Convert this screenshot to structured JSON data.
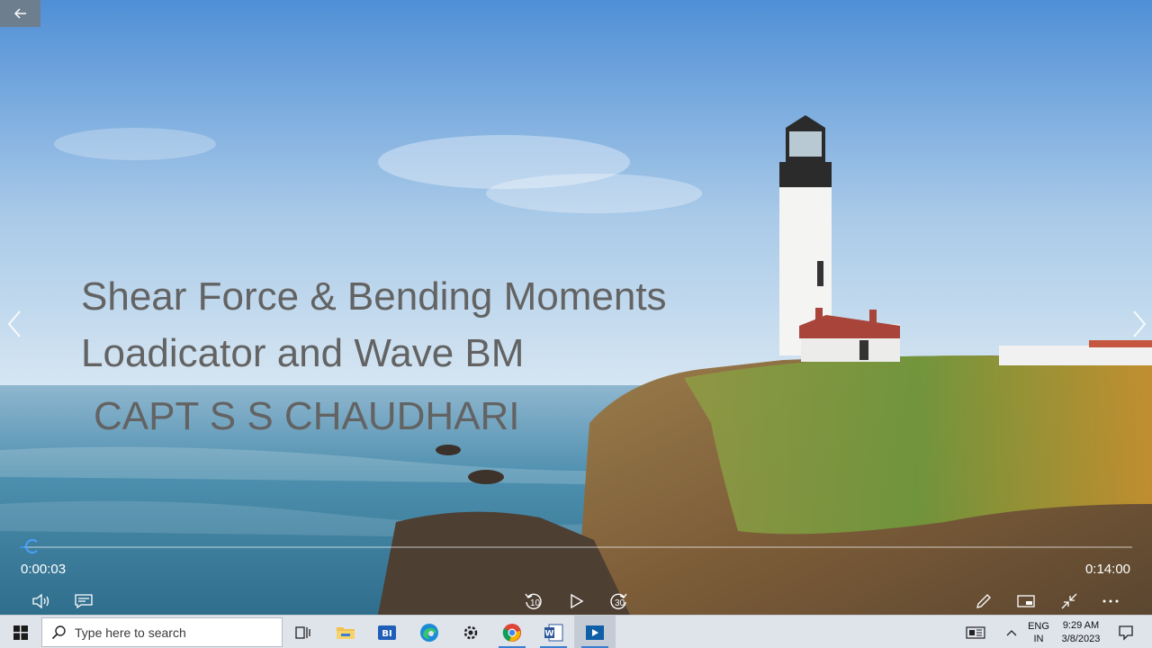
{
  "slide": {
    "line1": "Shear Force & Bending Moments",
    "line2": "Loadicator and Wave BM",
    "line3": "CAPT S S CHAUDHARI"
  },
  "player": {
    "time_current": "0:00:03",
    "time_total": "0:14:00",
    "progress": 0.004,
    "skip_back": "10",
    "skip_forward": "30"
  },
  "taskbar": {
    "search_placeholder": "Type here to search",
    "apps": [
      "task-view",
      "file-explorer",
      "bi-app",
      "edge",
      "settings",
      "chrome",
      "word",
      "movies-tv"
    ],
    "lang_line1": "ENG",
    "lang_line2": "IN",
    "time": "9:29 AM",
    "date": "3/8/2023"
  },
  "colors": {
    "title_text": "#636363",
    "accent": "#3a8ee6",
    "taskbar_bg": "#dfe3ea"
  }
}
